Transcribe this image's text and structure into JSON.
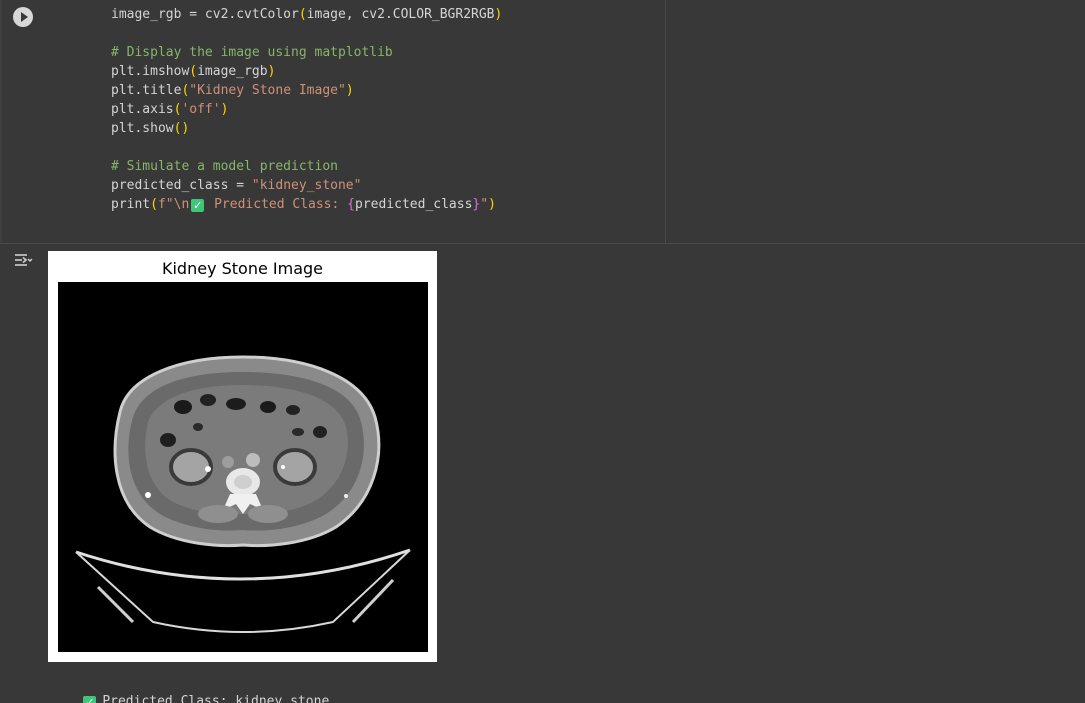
{
  "code_cell": {
    "run_label": "Run cell",
    "lines": [
      {
        "parts": [
          [
            "default",
            "image_rgb = cv2.cvtColor"
          ],
          [
            "paren",
            "("
          ],
          [
            "default",
            "image, cv2.COLOR_BGR2RGB"
          ],
          [
            "paren",
            ")"
          ]
        ]
      },
      {
        "parts": []
      },
      {
        "parts": [
          [
            "comment",
            "# Display the image using matplotlib"
          ]
        ]
      },
      {
        "parts": [
          [
            "default",
            "plt.imshow"
          ],
          [
            "paren",
            "("
          ],
          [
            "default",
            "image_rgb"
          ],
          [
            "paren",
            ")"
          ]
        ]
      },
      {
        "parts": [
          [
            "default",
            "plt.title"
          ],
          [
            "paren",
            "("
          ],
          [
            "string",
            "\"Kidney Stone Image\""
          ],
          [
            "paren",
            ")"
          ]
        ]
      },
      {
        "parts": [
          [
            "default",
            "plt.axis"
          ],
          [
            "paren",
            "("
          ],
          [
            "string",
            "'off'"
          ],
          [
            "paren",
            ")"
          ]
        ]
      },
      {
        "parts": [
          [
            "default",
            "plt.show"
          ],
          [
            "paren",
            "()"
          ]
        ]
      },
      {
        "parts": []
      },
      {
        "parts": [
          [
            "comment",
            "# Simulate a model prediction"
          ]
        ]
      },
      {
        "parts": [
          [
            "default",
            "predicted_class = "
          ],
          [
            "string",
            "\"kidney_stone\""
          ]
        ]
      },
      {
        "parts": [
          [
            "default",
            "print"
          ],
          [
            "paren",
            "("
          ],
          [
            "string",
            "f\"\\n"
          ],
          [
            "check",
            "✓"
          ],
          [
            "string",
            " Predicted Class: "
          ],
          [
            "brace",
            "{"
          ],
          [
            "default",
            "predicted_class"
          ],
          [
            "brace",
            "}"
          ],
          [
            "string",
            "\""
          ],
          [
            "paren",
            ")"
          ]
        ]
      }
    ]
  },
  "output": {
    "figure_title": "Kidney Stone Image",
    "stdout_check": "✓",
    "stdout_text": "Predicted Class: kidney_stone"
  },
  "icons": {
    "run": "play-circle-icon",
    "output": "output-toggle-icon",
    "check": "check-box-icon"
  },
  "colors": {
    "background": "#383838",
    "comment": "#87b56a",
    "string": "#ce9178",
    "paren": "#ffd700",
    "brace": "#da70d6",
    "check": "#3ec779"
  }
}
